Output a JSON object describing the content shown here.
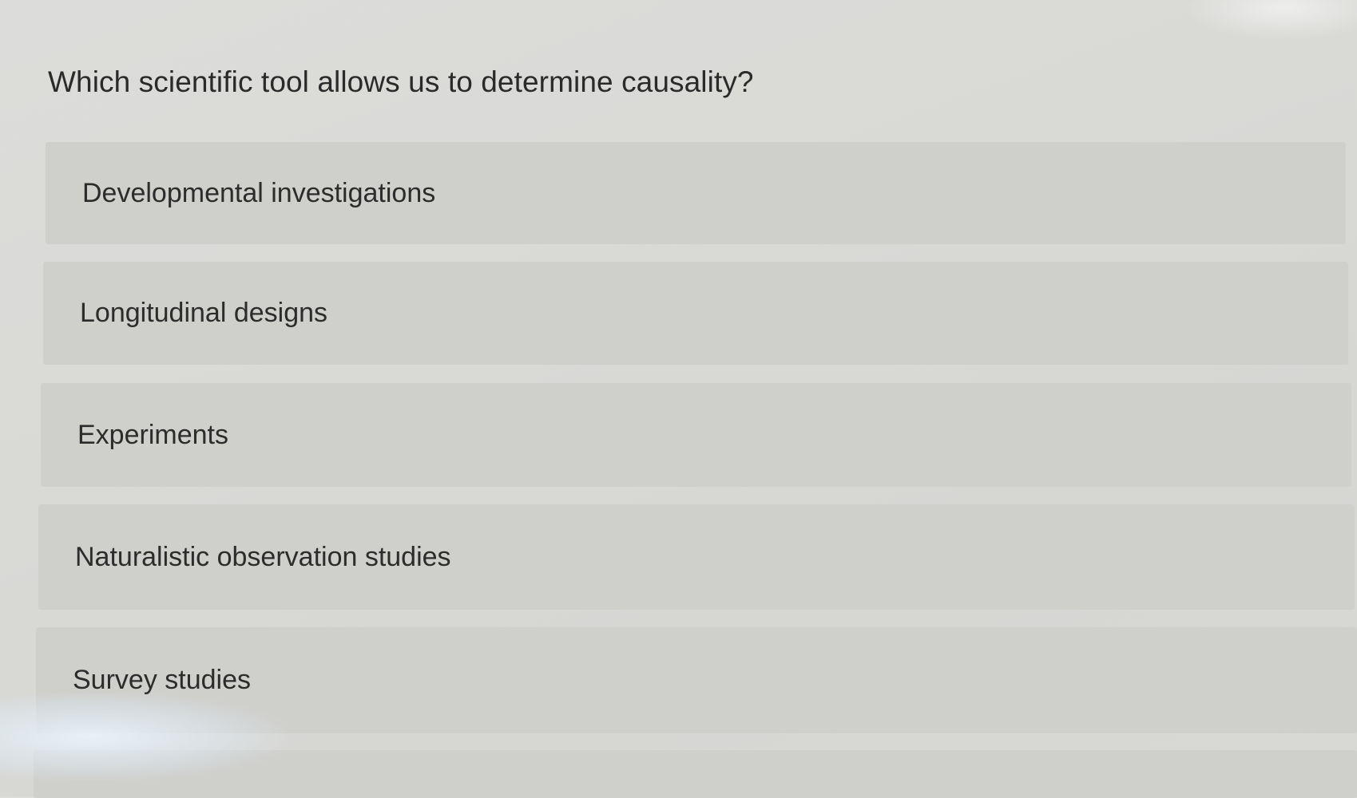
{
  "question": {
    "text": "Which scientific tool allows us to determine causality?"
  },
  "options": [
    {
      "label": "Developmental investigations"
    },
    {
      "label": "Longitudinal designs"
    },
    {
      "label": "Experiments"
    },
    {
      "label": "Naturalistic observation studies"
    },
    {
      "label": "Survey studies"
    },
    {
      "label": ""
    }
  ],
  "colors": {
    "background": "#d9d9d6",
    "option_background": "#cfcfcc",
    "text": "#2c2c2c"
  }
}
